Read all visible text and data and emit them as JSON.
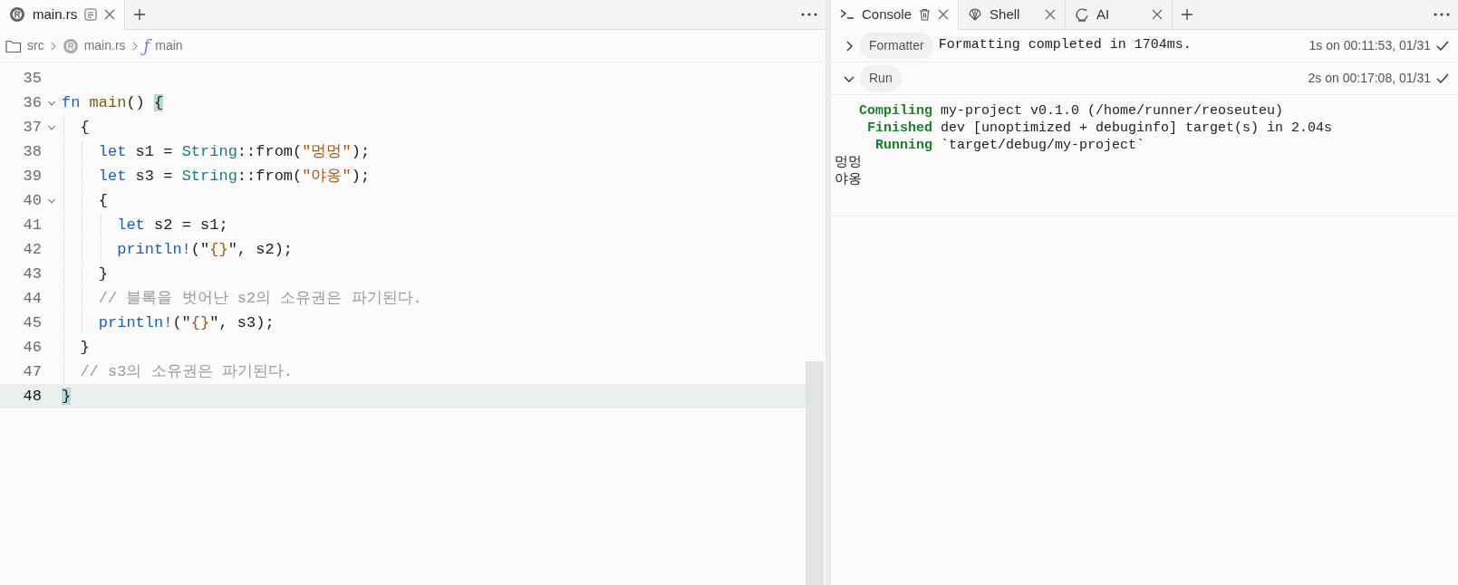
{
  "editor": {
    "tabs": [
      {
        "label": "main.rs",
        "selected": true
      }
    ],
    "breadcrumb": {
      "folder": "src",
      "file": "main.rs",
      "symbol_glyph": "ƒ",
      "symbol": "main"
    },
    "lines": [
      {
        "number": "35",
        "foldable": false,
        "current": false
      },
      {
        "number": "36",
        "foldable": true,
        "current": false,
        "tokens": [
          {
            "kind": "keyword",
            "text": "fn "
          },
          {
            "kind": "function",
            "text": "main"
          },
          {
            "kind": "plain",
            "text": "() "
          },
          {
            "kind": "bracket-match",
            "text": "{"
          }
        ]
      },
      {
        "number": "37",
        "foldable": true,
        "current": false,
        "tokens": [
          {
            "kind": "plain",
            "text": "  {"
          }
        ]
      },
      {
        "number": "38",
        "foldable": false,
        "current": false,
        "tokens": [
          {
            "kind": "keyword",
            "text": "    let"
          },
          {
            "kind": "plain",
            "text": " s1 = "
          },
          {
            "kind": "type",
            "text": "String"
          },
          {
            "kind": "plain",
            "text": "::from("
          },
          {
            "kind": "string",
            "text": "\"멍멍\""
          },
          {
            "kind": "plain",
            "text": ");"
          }
        ]
      },
      {
        "number": "39",
        "foldable": false,
        "current": false,
        "tokens": [
          {
            "kind": "keyword",
            "text": "    let"
          },
          {
            "kind": "plain",
            "text": " s3 = "
          },
          {
            "kind": "type",
            "text": "String"
          },
          {
            "kind": "plain",
            "text": "::from("
          },
          {
            "kind": "string",
            "text": "\"야옹\""
          },
          {
            "kind": "plain",
            "text": ");"
          }
        ]
      },
      {
        "number": "40",
        "foldable": true,
        "current": false,
        "tokens": [
          {
            "kind": "plain",
            "text": "    {"
          }
        ]
      },
      {
        "number": "41",
        "foldable": false,
        "current": false,
        "tokens": [
          {
            "kind": "keyword",
            "text": "      let"
          },
          {
            "kind": "plain",
            "text": " s2 = s1;"
          }
        ]
      },
      {
        "number": "42",
        "foldable": false,
        "current": false,
        "tokens": [
          {
            "kind": "keyword",
            "text": "      println!"
          },
          {
            "kind": "plain",
            "text": "(\""
          },
          {
            "kind": "string",
            "text": "{}"
          },
          {
            "kind": "plain",
            "text": "\", s2);"
          }
        ]
      },
      {
        "number": "43",
        "foldable": false,
        "current": false,
        "tokens": [
          {
            "kind": "plain",
            "text": "    }"
          }
        ]
      },
      {
        "number": "44",
        "foldable": false,
        "current": false,
        "tokens": [
          {
            "kind": "comment",
            "text": "    // 블록을 벗어난 s2의 소유권은 파기된다."
          }
        ]
      },
      {
        "number": "45",
        "foldable": false,
        "current": false,
        "tokens": [
          {
            "kind": "keyword",
            "text": "    println!"
          },
          {
            "kind": "plain",
            "text": "(\""
          },
          {
            "kind": "string",
            "text": "{}"
          },
          {
            "kind": "plain",
            "text": "\", s3);"
          }
        ]
      },
      {
        "number": "46",
        "foldable": false,
        "current": false,
        "tokens": [
          {
            "kind": "plain",
            "text": "  }"
          }
        ]
      },
      {
        "number": "47",
        "foldable": false,
        "current": false,
        "tokens": [
          {
            "kind": "comment",
            "text": "  // s3의 소유권은 파기된다."
          }
        ]
      },
      {
        "number": "48",
        "foldable": false,
        "current": true,
        "tokens": [
          {
            "kind": "bracket-match",
            "text": "}"
          }
        ]
      }
    ]
  },
  "tool_tabs": [
    {
      "label": "Console",
      "kind": "console",
      "selected": true,
      "trash": true
    },
    {
      "label": "Shell",
      "kind": "shell",
      "selected": false,
      "trash": false
    },
    {
      "label": "AI",
      "kind": "ai",
      "selected": false,
      "trash": false
    }
  ],
  "console": [
    {
      "badge": "Formatter",
      "expanded": false,
      "message": "Formatting completed in 1704ms.",
      "time": "1s on 00:11:53, 01/31"
    },
    {
      "badge": "Run",
      "expanded": true,
      "time": "2s on 00:17:08, 01/31",
      "output": [
        {
          "label": "   Compiling",
          "text": " my-project v0.1.0 (/home/runner/reoseuteu)"
        },
        {
          "label": "    Finished",
          "text": " dev [unoptimized + debuginfo] target(s) in 2.04s"
        },
        {
          "label": "     Running",
          "text": " `target/debug/my-project`"
        },
        {
          "text": "멍멍"
        },
        {
          "text": "야옹"
        }
      ]
    }
  ]
}
